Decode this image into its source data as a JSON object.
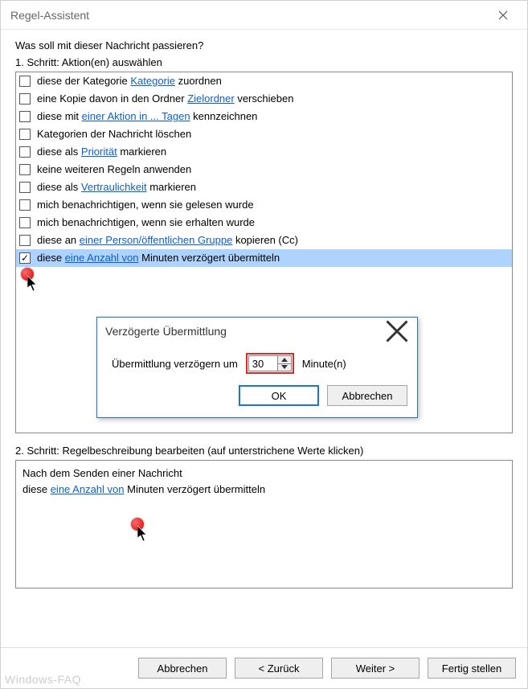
{
  "window": {
    "title": "Regel-Assistent",
    "question": "Was soll mit dieser Nachricht passieren?",
    "step1_label": "1. Schritt: Aktion(en) auswählen",
    "step2_label": "2. Schritt: Regelbeschreibung bearbeiten (auf unterstrichene Werte klicken)"
  },
  "actions": [
    {
      "checked": false,
      "parts": [
        {
          "t": "diese der Kategorie "
        },
        {
          "t": "Kategorie",
          "link": true
        },
        {
          "t": " zuordnen"
        }
      ]
    },
    {
      "checked": false,
      "parts": [
        {
          "t": "eine Kopie davon in den Ordner "
        },
        {
          "t": "Zielordner",
          "link": true
        },
        {
          "t": " verschieben"
        }
      ]
    },
    {
      "checked": false,
      "parts": [
        {
          "t": "diese mit "
        },
        {
          "t": "einer Aktion in ... Tagen",
          "link": true
        },
        {
          "t": " kennzeichnen"
        }
      ]
    },
    {
      "checked": false,
      "parts": [
        {
          "t": "Kategorien der Nachricht löschen"
        }
      ]
    },
    {
      "checked": false,
      "parts": [
        {
          "t": "diese als "
        },
        {
          "t": "Priorität",
          "link": true
        },
        {
          "t": " markieren"
        }
      ]
    },
    {
      "checked": false,
      "parts": [
        {
          "t": "keine weiteren Regeln anwenden"
        }
      ]
    },
    {
      "checked": false,
      "parts": [
        {
          "t": "diese als "
        },
        {
          "t": "Vertraulichkeit",
          "link": true
        },
        {
          "t": " markieren"
        }
      ]
    },
    {
      "checked": false,
      "parts": [
        {
          "t": "mich benachrichtigen, wenn sie gelesen wurde"
        }
      ]
    },
    {
      "checked": false,
      "parts": [
        {
          "t": "mich benachrichtigen, wenn sie erhalten wurde"
        }
      ]
    },
    {
      "checked": false,
      "parts": [
        {
          "t": "diese an "
        },
        {
          "t": "einer Person/öffentlichen Gruppe",
          "link": true
        },
        {
          "t": " kopieren (Cc)"
        }
      ]
    },
    {
      "checked": true,
      "selected": true,
      "parts": [
        {
          "t": "diese "
        },
        {
          "t": "eine Anzahl von",
          "link": true
        },
        {
          "t": " Minuten verzögert übermitteln"
        }
      ]
    }
  ],
  "description": {
    "line1": "Nach dem Senden einer Nachricht",
    "line2_pre": "diese ",
    "line2_link": "eine Anzahl von",
    "line2_post": " Minuten verzögert übermitteln"
  },
  "buttons": {
    "cancel": "Abbrechen",
    "back": "< Zurück",
    "next": "Weiter >",
    "finish": "Fertig stellen"
  },
  "modal": {
    "title": "Verzögerte Übermittlung",
    "label_pre": "Übermittlung verzögern um",
    "value": "30",
    "label_post": "Minute(n)",
    "ok": "OK",
    "cancel": "Abbrechen"
  },
  "watermark": "Windows-FAQ"
}
